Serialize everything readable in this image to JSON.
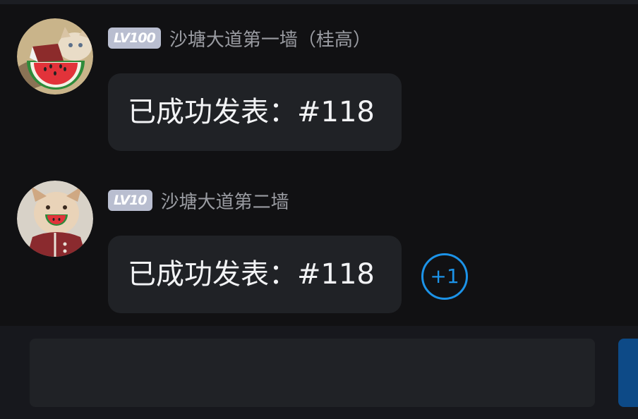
{
  "messages": [
    {
      "level": "LV100",
      "sender": "沙塘大道第一墙（桂高）",
      "text": "已成功发表：#118",
      "avatar_icon": "watermelon-cat-avatar-icon"
    },
    {
      "level": "LV10",
      "sender": "沙塘大道第二墙",
      "text": "已成功发表：#118",
      "avatar_icon": "watermelon-dog-avatar-icon",
      "reaction": "+1"
    }
  ],
  "composer": {
    "placeholder": ""
  },
  "colors": {
    "background": "#111113",
    "bubble": "#202226",
    "level_badge": "#b9bed0",
    "accent": "#1c93e8",
    "send_button": "#0d4a87"
  }
}
